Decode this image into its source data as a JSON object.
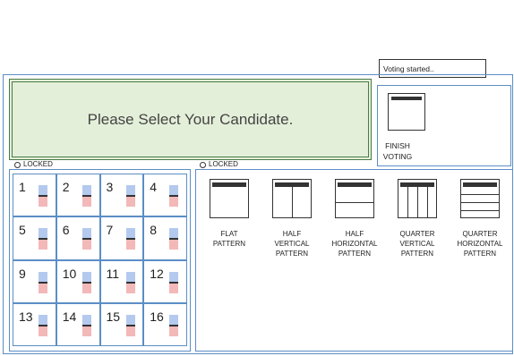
{
  "status": {
    "text": "Voting started.."
  },
  "message": {
    "text": "Please Select Your Candidate."
  },
  "finish": {
    "label_line1": "FINISH",
    "label_line2": "VOTING"
  },
  "locks": {
    "candidates": "LOCKED",
    "patterns": "LOCKED"
  },
  "candidates": [
    "1",
    "2",
    "3",
    "4",
    "5",
    "6",
    "7",
    "8",
    "9",
    "10",
    "11",
    "12",
    "13",
    "14",
    "15",
    "16"
  ],
  "patterns": [
    {
      "line1": "FLAT",
      "line2": "PATTERN",
      "line3": ""
    },
    {
      "line1": "HALF",
      "line2": "VERTICAL",
      "line3": "PATTERN"
    },
    {
      "line1": "HALF",
      "line2": "HORIZONTAL",
      "line3": "PATTERN"
    },
    {
      "line1": "QUARTER",
      "line2": "VERTICAL",
      "line3": "PATTERN"
    },
    {
      "line1": "QUARTER",
      "line2": "HORIZONTAL",
      "line3": "PATTERN"
    }
  ]
}
